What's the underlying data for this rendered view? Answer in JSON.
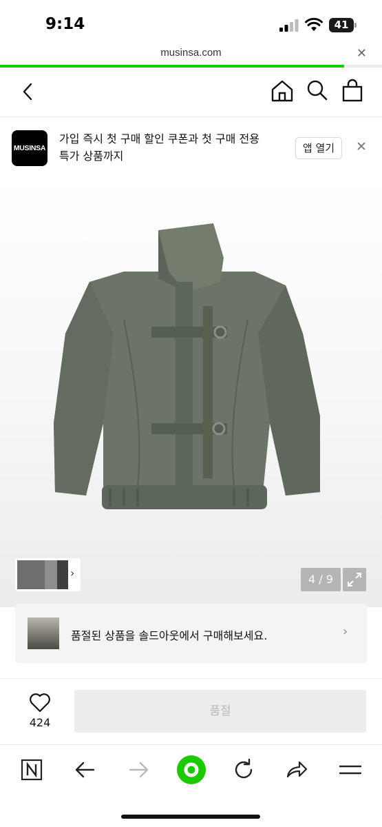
{
  "status_bar": {
    "time": "9:14",
    "battery": "41"
  },
  "browser": {
    "url": "musinsa.com",
    "load_progress_percent": 90
  },
  "header": {
    "icons": [
      "back-arrow-icon",
      "home-icon",
      "search-icon",
      "shopping-bag-icon"
    ]
  },
  "app_banner": {
    "logo_text": "MUSINSA",
    "message_line1": "가입 즉시 첫 구매 할인 쿠폰과 첫 구매 전용",
    "message_line2": "특가 상품까지",
    "open_label": "앱 열기"
  },
  "gallery": {
    "counter": "4 / 9",
    "current": 4,
    "total": 9
  },
  "soldout_card": {
    "text": "품절된 상품을 솔드아웃에서 구매해보세요."
  },
  "action_bar": {
    "like_count": "424",
    "buy_label": "품절"
  },
  "toolbar": {
    "icons": [
      "naver-n-icon",
      "back-icon",
      "forward-icon",
      "green-dot-home-icon",
      "refresh-icon",
      "share-icon",
      "menu-icon"
    ]
  },
  "colors": {
    "accent_green": "#1ec800",
    "jacket": "#6b7466"
  }
}
